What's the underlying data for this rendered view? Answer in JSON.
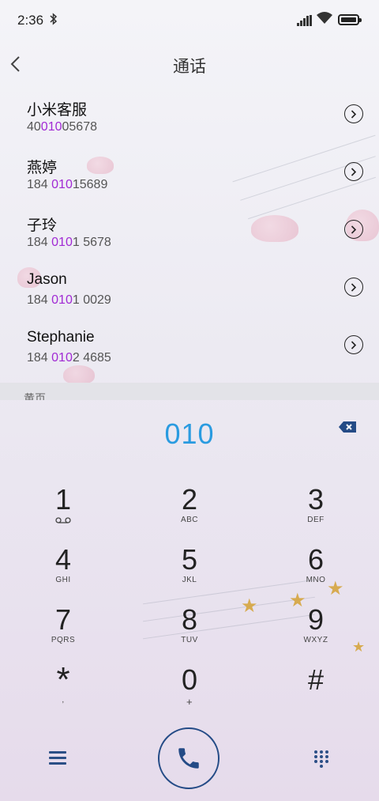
{
  "status_bar": {
    "time": "2:36"
  },
  "header": {
    "title": "通话"
  },
  "contacts": [
    {
      "name": "小米客服",
      "number_pre": "40",
      "number_match": "010",
      "number_post": "05678"
    },
    {
      "name": "燕婷",
      "number_pre": "184 ",
      "number_match": "010",
      "number_post": "15689"
    },
    {
      "name": "子玲",
      "number_pre": "184 ",
      "number_match": "010",
      "number_post": "1 5678"
    },
    {
      "name": "Jason",
      "number_pre": "184 ",
      "number_match": "010",
      "number_post": "1 0029"
    },
    {
      "name": "Stephanie",
      "number_pre": "184 ",
      "number_match": "010",
      "number_post": "2 4685"
    }
  ],
  "section": {
    "label": "黄页"
  },
  "dialer": {
    "entered": "010",
    "keys": [
      {
        "digit": "1",
        "letters": ""
      },
      {
        "digit": "2",
        "letters": "ABC"
      },
      {
        "digit": "3",
        "letters": "DEF"
      },
      {
        "digit": "4",
        "letters": "GHI"
      },
      {
        "digit": "5",
        "letters": "JKL"
      },
      {
        "digit": "6",
        "letters": "MNO"
      },
      {
        "digit": "7",
        "letters": "PQRS"
      },
      {
        "digit": "8",
        "letters": "TUV"
      },
      {
        "digit": "9",
        "letters": "WXYZ"
      },
      {
        "digit": "*",
        "letters": ","
      },
      {
        "digit": "0",
        "letters": "+"
      },
      {
        "digit": "#",
        "letters": ""
      }
    ]
  },
  "colors": {
    "accent": "#2a9be0",
    "match": "#a12ad4",
    "call": "#244b86"
  },
  "icons": [
    "bluetooth-icon",
    "signal-icon",
    "wifi-icon",
    "battery-icon",
    "back-icon",
    "chevron-right-icon",
    "backspace-icon",
    "voicemail-icon",
    "menu-icon",
    "phone-icon",
    "dialpad-icon"
  ]
}
